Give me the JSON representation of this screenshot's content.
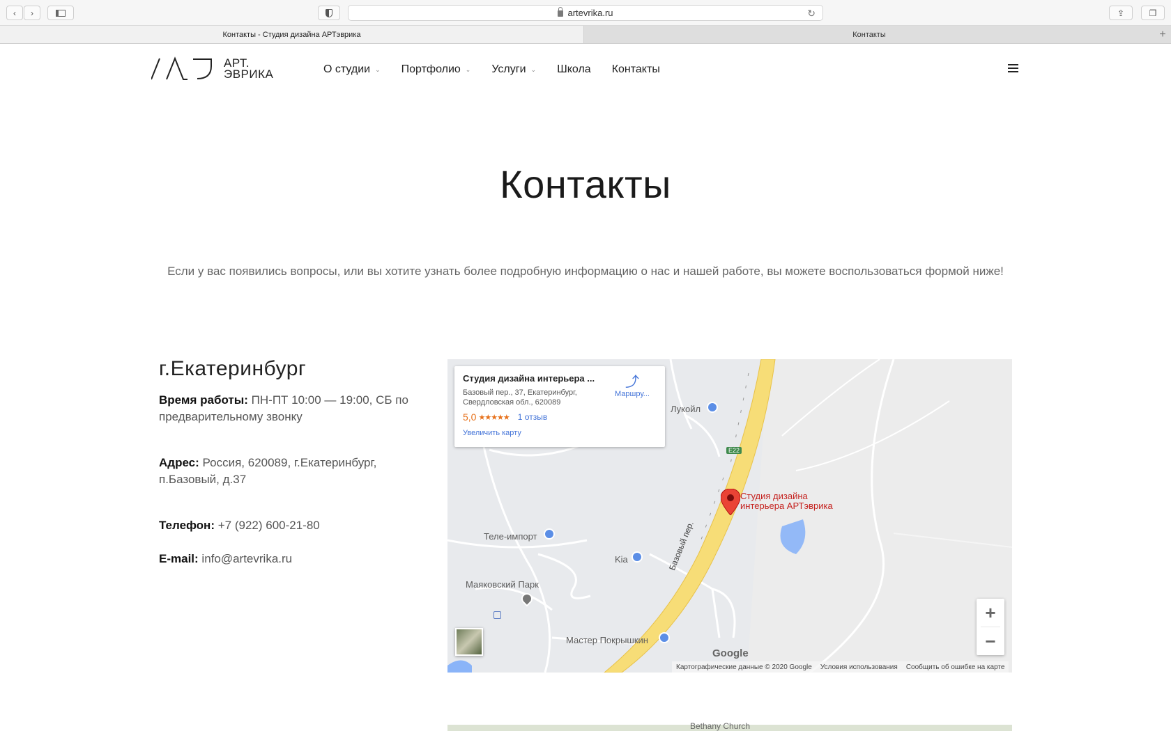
{
  "browser": {
    "url": "artevrika.ru",
    "tabs": [
      {
        "title": "Контакты - Студия дизайна АРТэврика"
      },
      {
        "title": "Контакты"
      }
    ],
    "tab_add": "+"
  },
  "header": {
    "logo_line1": "АРТ.",
    "logo_line2": "ЭВРИКА",
    "nav": [
      {
        "label": "О студии",
        "dropdown": true
      },
      {
        "label": "Портфолио",
        "dropdown": true
      },
      {
        "label": "Услуги",
        "dropdown": true
      },
      {
        "label": "Школа",
        "dropdown": false
      },
      {
        "label": "Контакты",
        "dropdown": false
      }
    ]
  },
  "page": {
    "title": "Контакты",
    "intro": "Если у вас появились вопросы, или вы хотите узнать более подробную информацию о нас и нашей работе, вы можете воспользоваться формой ниже!"
  },
  "contacts": {
    "city": "г.Екатеринбург",
    "hours_label": "Время работы:",
    "hours_value": "ПН-ПТ 10:00 — 19:00, СБ по предварительному звонку",
    "address_label": "Адрес:",
    "address_value": "Россия, 620089, г.Екатеринбург, п.Базовый, д.37",
    "phone_label": "Телефон:",
    "phone_value": "+7 (922) 600-21-80",
    "email_label": "E-mail:",
    "email_value": "info@artevrika.ru"
  },
  "map": {
    "card_title": "Студия дизайна интерьера ...",
    "card_address": "Базовый пер., 37, Екатеринбург, Свердловская обл., 620089",
    "rating": "5,0",
    "stars": "★★★★★",
    "reviews": "1 отзыв",
    "enlarge": "Увеличить карту",
    "route": "Маршру...",
    "pin_label": "Студия дизайна интерьера АРТэврика",
    "places": {
      "lukoil": "Лукойл",
      "tele_import": "Теле-импорт",
      "kia": "Kia",
      "mayakovsky": "Маяковский Парк",
      "master": "Мастер Покрышкин",
      "road": "Базовый пер.",
      "route_sign": "E22"
    },
    "google": "Google",
    "attribution": [
      "Картографические данные © 2020 Google",
      "Условия использования",
      "Сообщить об ошибке на карте"
    ],
    "zoom_in": "+",
    "zoom_out": "−",
    "map2_label": "Bethany Church"
  }
}
